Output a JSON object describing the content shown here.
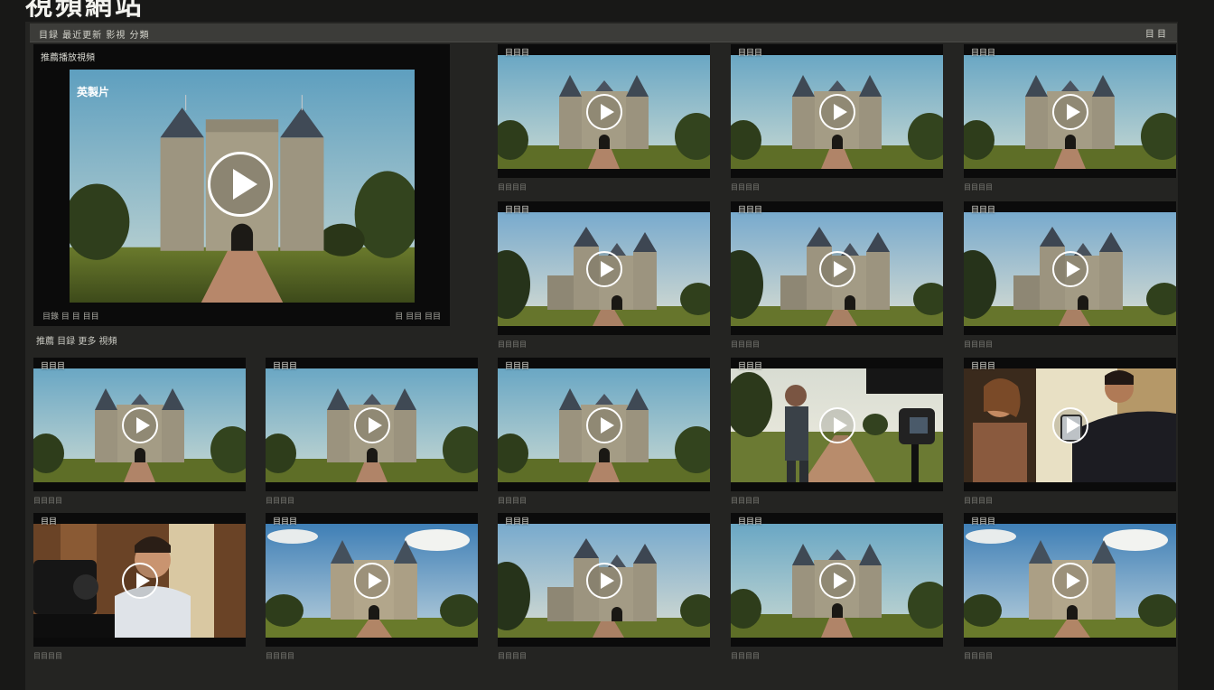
{
  "title": "視頻網站",
  "toolbar": {
    "left_text": "目録 最近更新 影視 分類",
    "right_text": "目 目"
  },
  "featured": {
    "label": "推薦播放視頻",
    "overlay_text": "英製片",
    "meta_left": "目錄 目 目 目目",
    "meta_right": "目 目目 目目"
  },
  "section_label": "推薦 目録 更多 視頻",
  "cards": [
    {
      "label": "目目目",
      "duration": "目目目目",
      "scene": "castle-a"
    },
    {
      "label": "目目目",
      "duration": "目目目目",
      "scene": "castle-a"
    },
    {
      "label": "目目目",
      "duration": "目目目目",
      "scene": "castle-a"
    },
    {
      "label": "目目目",
      "duration": "目目目目",
      "scene": "castle-b"
    },
    {
      "label": "目目目",
      "duration": "目目目目",
      "scene": "castle-b"
    },
    {
      "label": "目目目",
      "duration": "目目目目",
      "scene": "castle-b"
    },
    {
      "label": "目目目",
      "duration": "目目目目",
      "scene": "castle-a"
    },
    {
      "label": "目目目",
      "duration": "目目目目",
      "scene": "castle-a"
    },
    {
      "label": "目目目",
      "duration": "目目目目",
      "scene": "castle-a"
    },
    {
      "label": "目目目",
      "duration": "目目目目",
      "scene": "camera-man"
    },
    {
      "label": "目目目",
      "duration": "目目目目",
      "scene": "couple"
    },
    {
      "label": "目目",
      "duration": "目目目目",
      "scene": "presenter"
    },
    {
      "label": "目目目",
      "duration": "目目目目",
      "scene": "castle-clouds"
    },
    {
      "label": "目目目",
      "duration": "目目目目",
      "scene": "castle-b"
    },
    {
      "label": "目目目",
      "duration": "目目目目",
      "scene": "castle-a"
    },
    {
      "label": "目目目",
      "duration": "目目目目",
      "scene": "castle-clouds"
    }
  ]
}
